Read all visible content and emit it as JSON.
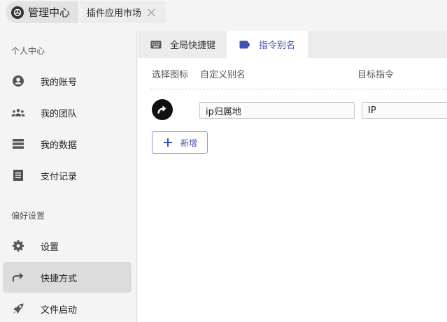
{
  "breadcrumb": {
    "main_label": "管理中心",
    "sub_label": "插件应用市场"
  },
  "sidebar": {
    "personal_title": "个人中心",
    "preference_title": "偏好设置",
    "items": [
      {
        "label": "我的账号",
        "icon": "account-icon"
      },
      {
        "label": "我的团队",
        "icon": "team-icon"
      },
      {
        "label": "我的数据",
        "icon": "data-icon"
      },
      {
        "label": "支付记录",
        "icon": "receipt-icon"
      },
      {
        "label": "设置",
        "icon": "gear-icon"
      },
      {
        "label": "快捷方式",
        "icon": "shortcut-arrow-icon",
        "active": true
      },
      {
        "label": "文件启动",
        "icon": "rocket-icon"
      }
    ]
  },
  "tabs": [
    {
      "label": "全局快捷键",
      "icon": "keyboard-icon"
    },
    {
      "label": "指令别名",
      "icon": "label-tag-icon",
      "active": true
    }
  ],
  "table": {
    "col_icon": "选择图标",
    "col_alias": "自定义别名",
    "col_target": "目标指令",
    "rows": [
      {
        "alias": "ip归属地",
        "target": "IP",
        "icon": "shortcut-arrow-icon"
      }
    ]
  },
  "add_button": "新增",
  "colors": {
    "accent": "#3f51b5",
    "active_bg": "#dcdcdc"
  }
}
